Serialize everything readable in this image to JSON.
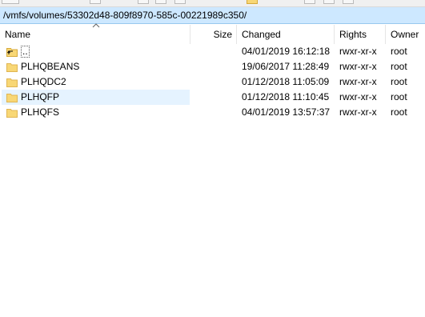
{
  "path": "/vmfs/volumes/53302d48-809f8970-585c-00221989c350/",
  "columns": {
    "name": "Name",
    "size": "Size",
    "changed": "Changed",
    "rights": "Rights",
    "owner": "Owner"
  },
  "rows": [
    {
      "name": "..",
      "changed": "04/01/2019 16:12:18",
      "rights": "rwxr-xr-x",
      "owner": "root",
      "icon": "parent-folder-icon"
    },
    {
      "name": "PLHQBEANS",
      "changed": "19/06/2017 11:28:49",
      "rights": "rwxr-xr-x",
      "owner": "root",
      "icon": "folder-icon"
    },
    {
      "name": "PLHQDC2",
      "changed": "01/12/2018 11:05:09",
      "rights": "rwxr-xr-x",
      "owner": "root",
      "icon": "folder-icon"
    },
    {
      "name": "PLHQFP",
      "changed": "01/12/2018 11:10:45",
      "rights": "rwxr-xr-x",
      "owner": "root",
      "icon": "folder-icon",
      "selected": true
    },
    {
      "name": "PLHQFS",
      "changed": "04/01/2019 13:57:37",
      "rights": "rwxr-xr-x",
      "owner": "root",
      "icon": "folder-icon"
    }
  ],
  "colors": {
    "path_bar": "#cde8ff",
    "selection": "#e5f3ff",
    "folder": "#f8d775"
  }
}
